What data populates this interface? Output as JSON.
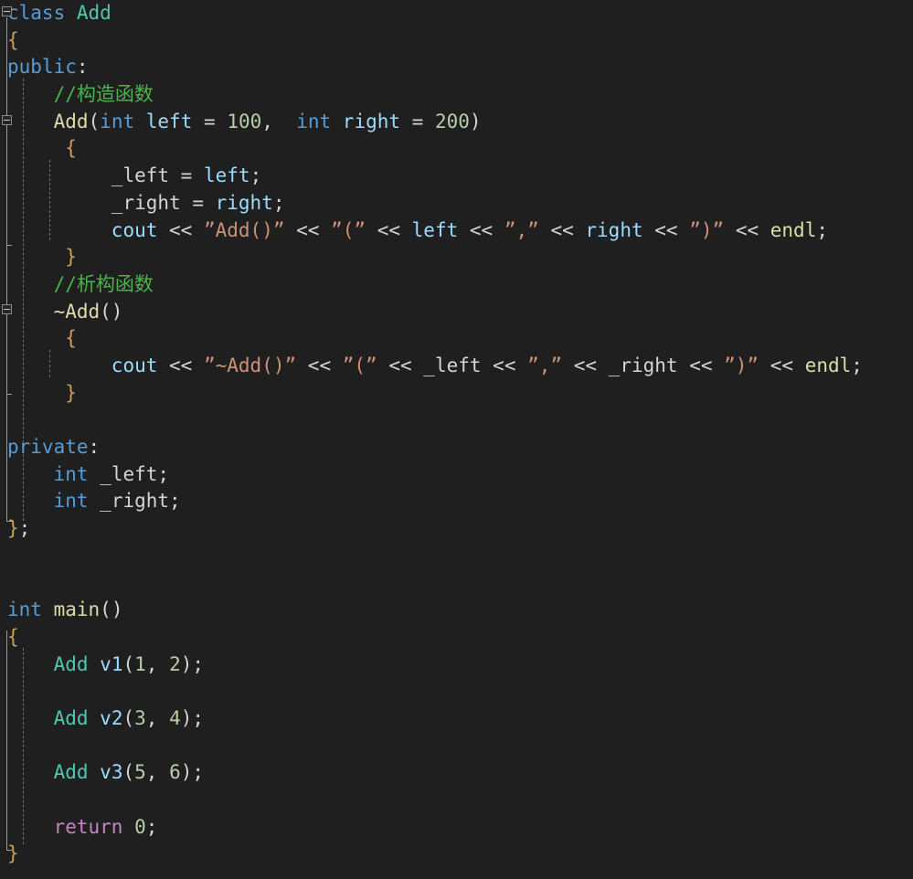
{
  "editor": {
    "language": "cpp",
    "theme": "dark",
    "background_color": "#1f1f1f",
    "font_size_px": 21,
    "line_height_px": 29.7,
    "line_numbers_visible": false
  },
  "colors": {
    "background": "#1f1f1f",
    "keyword": "#569cd6",
    "class_name": "#4ec9b0",
    "function": "#dcdcaa",
    "comment": "#4db14d",
    "string": "#ce9178",
    "number": "#b5cea8",
    "variable": "#9cdcfe",
    "operator": "#d4d4d4",
    "brace": "#c8a05a",
    "return_keyword": "#c586c0",
    "indent_guide": "#707070",
    "fold_marker": "#8a8a8a"
  },
  "gutter": {
    "fold_markers": [
      {
        "name": "fold-class-Add",
        "collapsed": false,
        "glyph": "minus"
      },
      {
        "name": "fold-constructor",
        "collapsed": false,
        "glyph": "minus"
      },
      {
        "name": "fold-destructor",
        "collapsed": false,
        "glyph": "minus"
      }
    ]
  },
  "code": {
    "lines": [
      {
        "n": 1,
        "text": "class Add"
      },
      {
        "n": 2,
        "text": "{"
      },
      {
        "n": 3,
        "text": "public:"
      },
      {
        "n": 4,
        "text": "    //构造函数"
      },
      {
        "n": 5,
        "text": "    Add(int left = 100, int right = 200)"
      },
      {
        "n": 6,
        "text": "    {"
      },
      {
        "n": 7,
        "text": "        _left = left;"
      },
      {
        "n": 8,
        "text": "        _right = right;"
      },
      {
        "n": 9,
        "text": "        cout << ”Add()” << ”(” << left << ”,” << right << ”)” << endl;"
      },
      {
        "n": 10,
        "text": "    }"
      },
      {
        "n": 11,
        "text": "    //析构函数"
      },
      {
        "n": 12,
        "text": "    ~Add()"
      },
      {
        "n": 13,
        "text": "    {"
      },
      {
        "n": 14,
        "text": "        cout << ”~Add()” << ”(” << _left << ”,” << _right << ”)” << endl;"
      },
      {
        "n": 15,
        "text": "    }"
      },
      {
        "n": 16,
        "text": ""
      },
      {
        "n": 17,
        "text": "private:"
      },
      {
        "n": 18,
        "text": "    int _left;"
      },
      {
        "n": 19,
        "text": "    int _right;"
      },
      {
        "n": 20,
        "text": "};"
      },
      {
        "n": 21,
        "text": ""
      },
      {
        "n": 22,
        "text": ""
      },
      {
        "n": 23,
        "text": "int main()"
      },
      {
        "n": 24,
        "text": "{"
      },
      {
        "n": 25,
        "text": "    Add v1(1, 2);"
      },
      {
        "n": 26,
        "text": ""
      },
      {
        "n": 27,
        "text": "    Add v2(3, 4);"
      },
      {
        "n": 28,
        "text": ""
      },
      {
        "n": 29,
        "text": "    Add v3(5, 6);"
      },
      {
        "n": 30,
        "text": ""
      },
      {
        "n": 31,
        "text": "    return 0;"
      },
      {
        "n": 32,
        "text": "}"
      }
    ],
    "tokens": {
      "kw_class": "class",
      "kw_public": "public",
      "kw_private": "private",
      "kw_int": "int",
      "kw_return": "return",
      "class_name": "Add",
      "ctor_name": "Add",
      "dtor_name": "~Add",
      "main_name": "main",
      "comment_ctor": "//构造函数",
      "comment_dtor": "//析构函数",
      "param_left": "left",
      "param_right": "right",
      "member_left": "_left",
      "member_right": "_right",
      "default_left": "100",
      "default_right": "200",
      "stream_out": "cout",
      "stream_endl": "endl",
      "shift_op": "<<",
      "assign_op": "=",
      "str_add_call": "”Add()”",
      "str_dtor_call": "”~Add()”",
      "str_open_paren": "”(”",
      "str_comma": "”,”",
      "str_close_paren": "”)”",
      "var_v1": "v1",
      "var_v2": "v2",
      "var_v3": "v3",
      "args_v1": [
        "1",
        "2"
      ],
      "args_v2": [
        "3",
        "4"
      ],
      "args_v3": [
        "5",
        "6"
      ],
      "return_value": "0",
      "semicolon": ";",
      "brace_open": "{",
      "brace_close": "}",
      "brace_close_semi": "};"
    }
  }
}
